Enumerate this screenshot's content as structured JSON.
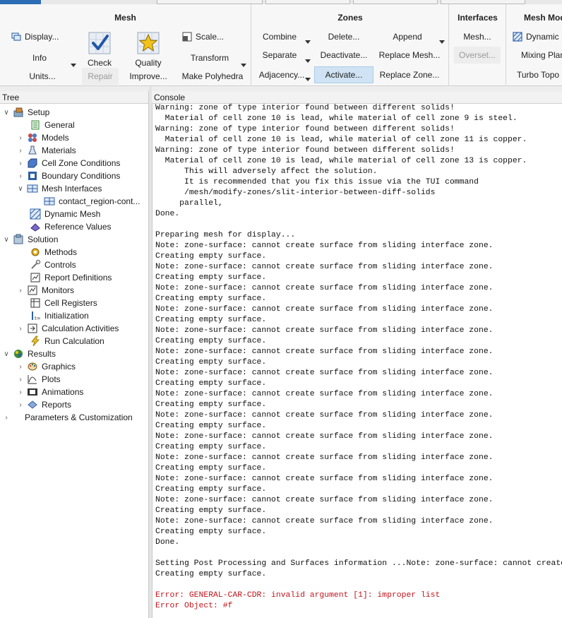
{
  "ribbon": {
    "mesh": {
      "title": "Mesh",
      "display": "Display...",
      "info": "Info",
      "units": "Units...",
      "check": "Check",
      "repair": "Repair",
      "quality": "Quality",
      "improve": "Improve...",
      "scale": "Scale...",
      "transform": "Transform",
      "polyhedra": "Make Polyhedra"
    },
    "zones": {
      "title": "Zones",
      "combine": "Combine",
      "separate": "Separate",
      "adjacency": "Adjacency...",
      "delete": "Delete...",
      "deactivate": "Deactivate...",
      "activate": "Activate...",
      "append": "Append",
      "replace_mesh": "Replace Mesh...",
      "replace_zone": "Replace Zone..."
    },
    "interfaces": {
      "title": "Interfaces",
      "mesh": "Mesh...",
      "overset": "Overset..."
    },
    "mesh_models": {
      "title": "Mesh Mod",
      "dynamic": "Dynamic M",
      "mixing": "Mixing Plan",
      "turbo": "Turbo Topo"
    }
  },
  "tree": {
    "header": "Tree",
    "items": [
      {
        "label": "Setup"
      },
      {
        "label": "General"
      },
      {
        "label": "Models"
      },
      {
        "label": "Materials"
      },
      {
        "label": "Cell Zone Conditions"
      },
      {
        "label": "Boundary Conditions"
      },
      {
        "label": "Mesh Interfaces"
      },
      {
        "label": "contact_region-cont..."
      },
      {
        "label": "Dynamic Mesh"
      },
      {
        "label": "Reference Values"
      },
      {
        "label": "Solution"
      },
      {
        "label": "Methods"
      },
      {
        "label": "Controls"
      },
      {
        "label": "Report Definitions"
      },
      {
        "label": "Monitors"
      },
      {
        "label": "Cell Registers"
      },
      {
        "label": "Initialization"
      },
      {
        "label": "Calculation Activities"
      },
      {
        "label": "Run Calculation"
      },
      {
        "label": "Results"
      },
      {
        "label": "Graphics"
      },
      {
        "label": "Plots"
      },
      {
        "label": "Animations"
      },
      {
        "label": "Reports"
      },
      {
        "label": "Parameters & Customization"
      }
    ]
  },
  "console": {
    "header": "Console",
    "lines": [
      {
        "text": "Warning: zone of type interior found between different solids!"
      },
      {
        "text": "  Material of cell zone 10 is lead, while material of cell zone 9 is steel."
      },
      {
        "text": "Warning: zone of type interior found between different solids!"
      },
      {
        "text": "  Material of cell zone 10 is lead, while material of cell zone 11 is copper."
      },
      {
        "text": "Warning: zone of type interior found between different solids!"
      },
      {
        "text": "  Material of cell zone 10 is lead, while material of cell zone 13 is copper."
      },
      {
        "text": "      This will adversely affect the solution."
      },
      {
        "text": "      It is recommended that you fix this issue via the TUI command"
      },
      {
        "text": "      /mesh/modify-zones/slit-interior-between-diff-solids"
      },
      {
        "text": "     parallel,"
      },
      {
        "text": "Done."
      },
      {
        "text": ""
      },
      {
        "text": "Preparing mesh for display..."
      },
      {
        "text": "Note: zone-surface: cannot create surface from sliding interface zone."
      },
      {
        "text": "Creating empty surface."
      },
      {
        "text": "Note: zone-surface: cannot create surface from sliding interface zone."
      },
      {
        "text": "Creating empty surface."
      },
      {
        "text": "Note: zone-surface: cannot create surface from sliding interface zone."
      },
      {
        "text": "Creating empty surface."
      },
      {
        "text": "Note: zone-surface: cannot create surface from sliding interface zone."
      },
      {
        "text": "Creating empty surface."
      },
      {
        "text": "Note: zone-surface: cannot create surface from sliding interface zone."
      },
      {
        "text": "Creating empty surface."
      },
      {
        "text": "Note: zone-surface: cannot create surface from sliding interface zone."
      },
      {
        "text": "Creating empty surface."
      },
      {
        "text": "Note: zone-surface: cannot create surface from sliding interface zone."
      },
      {
        "text": "Creating empty surface."
      },
      {
        "text": "Note: zone-surface: cannot create surface from sliding interface zone."
      },
      {
        "text": "Creating empty surface."
      },
      {
        "text": "Note: zone-surface: cannot create surface from sliding interface zone."
      },
      {
        "text": "Creating empty surface."
      },
      {
        "text": "Note: zone-surface: cannot create surface from sliding interface zone."
      },
      {
        "text": "Creating empty surface."
      },
      {
        "text": "Note: zone-surface: cannot create surface from sliding interface zone."
      },
      {
        "text": "Creating empty surface."
      },
      {
        "text": "Note: zone-surface: cannot create surface from sliding interface zone."
      },
      {
        "text": "Creating empty surface."
      },
      {
        "text": "Note: zone-surface: cannot create surface from sliding interface zone."
      },
      {
        "text": "Creating empty surface."
      },
      {
        "text": "Note: zone-surface: cannot create surface from sliding interface zone."
      },
      {
        "text": "Creating empty surface."
      },
      {
        "text": "Done."
      },
      {
        "text": ""
      },
      {
        "text": "Setting Post Processing and Surfaces information ...Note: zone-surface: cannot create surface from sliding interface zone."
      },
      {
        "text": "Creating empty surface."
      },
      {
        "text": ""
      },
      {
        "text": "Error: GENERAL-CAR-CDR: invalid argument [1]: improper list",
        "error": true
      },
      {
        "text": "Error Object: #f",
        "error": true
      }
    ]
  }
}
